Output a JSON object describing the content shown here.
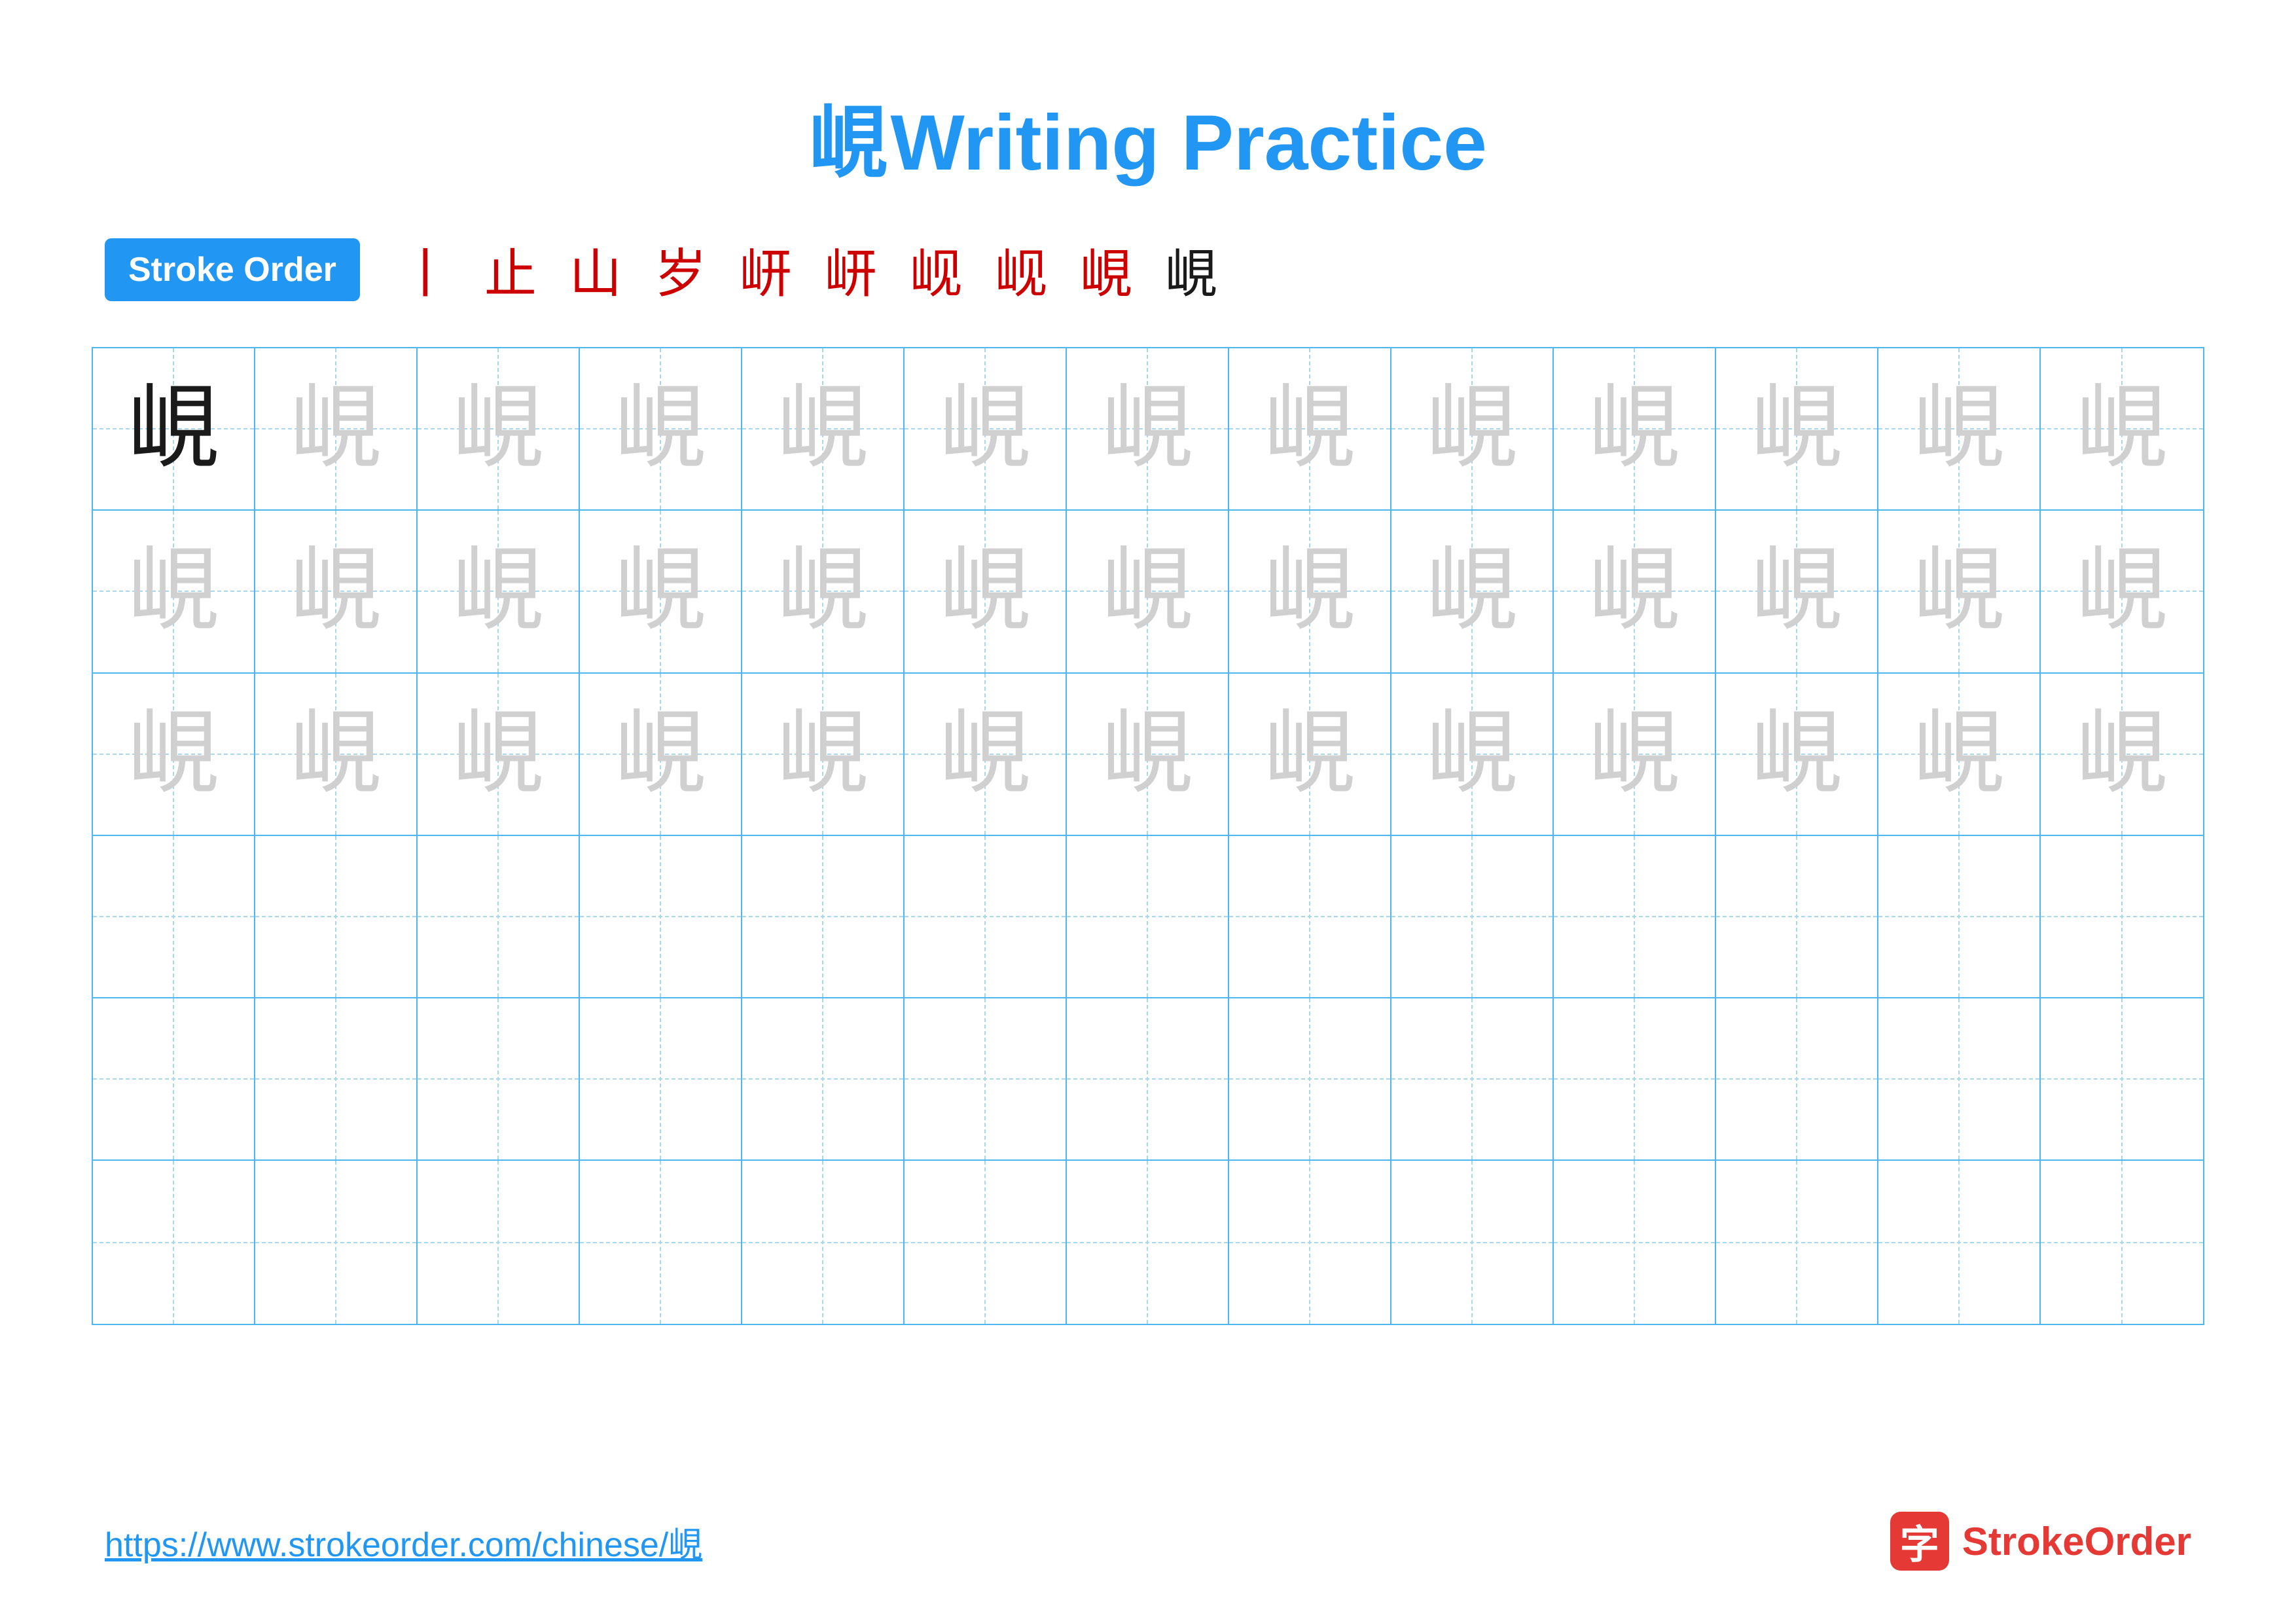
{
  "title": {
    "char": "峴",
    "label": "Writing Practice"
  },
  "stroke_order": {
    "badge": "Stroke Order",
    "strokes": [
      "丨",
      "⺊",
      "山",
      "山",
      "岁",
      "岍",
      "岍",
      "岘",
      "岘",
      "峴"
    ]
  },
  "grid": {
    "rows": 6,
    "cols": 13,
    "char": "峴",
    "row_types": [
      "solid_then_light",
      "light",
      "light",
      "empty",
      "empty",
      "empty"
    ]
  },
  "footer": {
    "url": "https://www.strokeorder.com/chinese/峴",
    "logo_char": "字",
    "logo_text": "StrokeOrder"
  }
}
